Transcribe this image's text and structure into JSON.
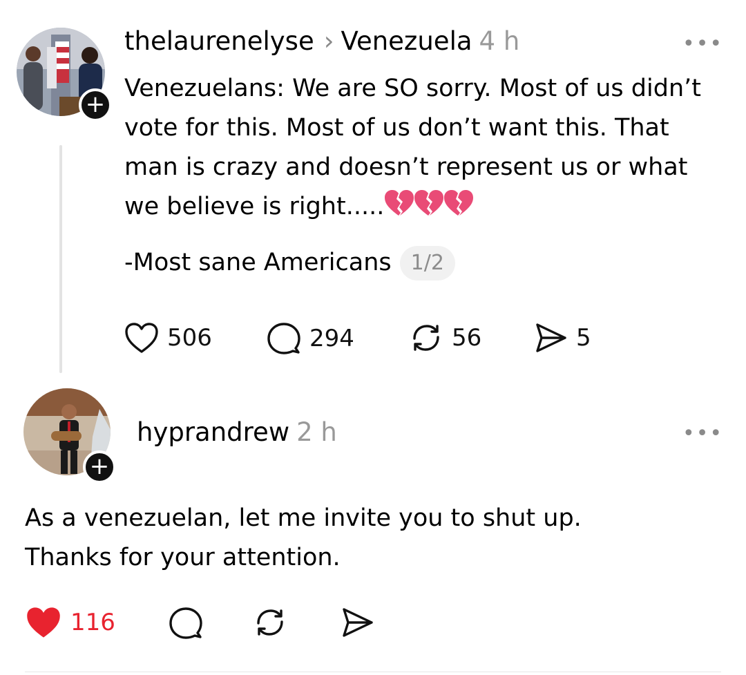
{
  "post": {
    "username": "thelaurenelyse",
    "community": "Venezuela",
    "time": "4 h",
    "more": "•••",
    "lines": [
      "Venezuelans: We are SO sorry. Most of us didn’t",
      "vote for this. Most of us don’t want this. That",
      "man is crazy and doesn’t represent us or what",
      "we believe is right....."
    ],
    "signature": "-Most sane Americans",
    "counter": "1/2",
    "likes": "506",
    "replies": "294",
    "reposts": "56",
    "shares": "5",
    "follow_plus": "+"
  },
  "reply": {
    "username": "hyprandrew",
    "time": "2 h",
    "more": "•••",
    "lines": [
      "As a venezuelan, let me invite you to shut up.",
      "Thanks for your attention."
    ],
    "likes": "116",
    "follow_plus": "+"
  },
  "colors": {
    "heart_liked": "#e8232f",
    "broken_heart": "#e94b76",
    "muted": "#999999"
  }
}
